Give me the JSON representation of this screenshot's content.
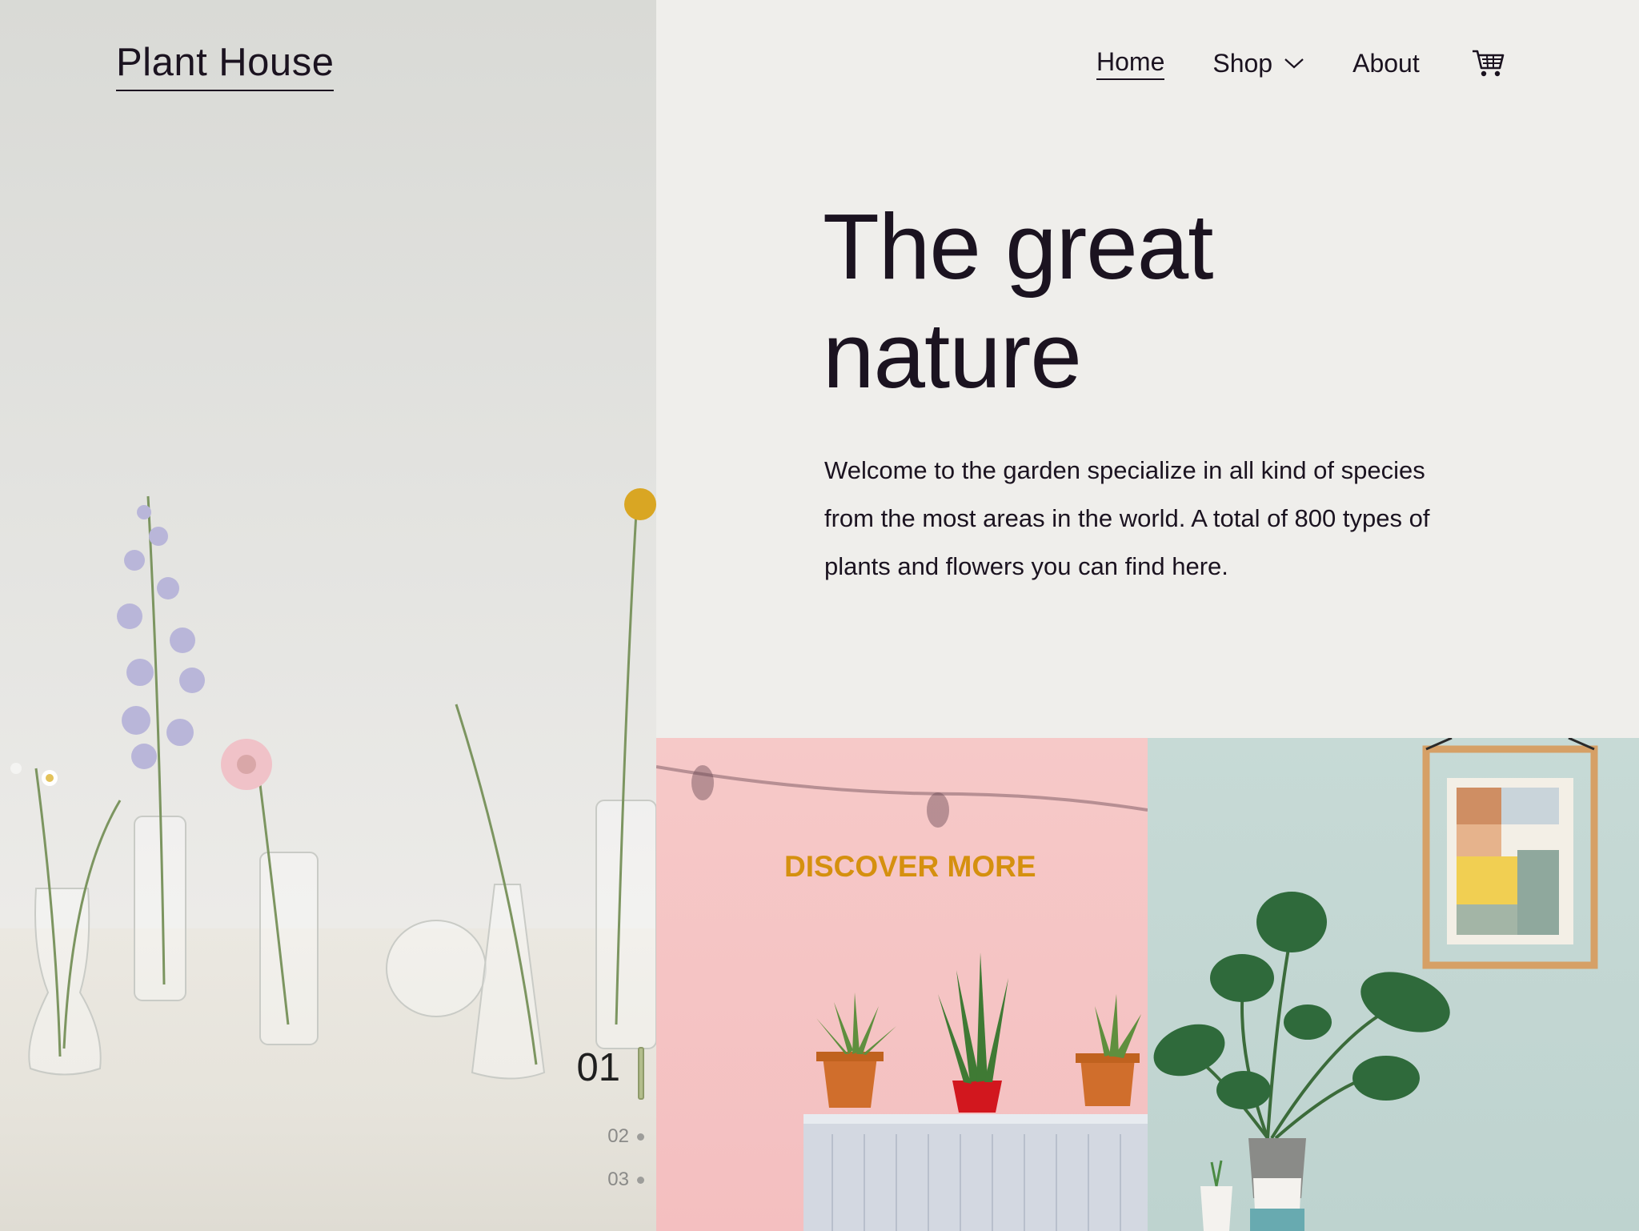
{
  "brand": {
    "name": "Plant House"
  },
  "nav": {
    "items": [
      {
        "label": "Home",
        "active": true
      },
      {
        "label": "Shop",
        "has_dropdown": true
      },
      {
        "label": "About"
      }
    ],
    "cart_icon": "cart-icon"
  },
  "hero": {
    "title_line1": "The great",
    "title_line2": "nature",
    "description": "Welcome to the garden specialize in all kind of species from the most areas in the world. A total of 800 types of plants and flowers you can find here."
  },
  "slider": {
    "current": "01",
    "others": [
      "02",
      "03"
    ]
  },
  "tiles": {
    "pink": {
      "cta": "DISCOVER MORE"
    }
  },
  "colors": {
    "text": "#1b1320",
    "accent": "#d5900f",
    "background": "#efeeeb",
    "pink_tile": "#f4bfc0",
    "teal_tile": "#c3d7d3",
    "slider_bar": "#b2bd8b"
  }
}
